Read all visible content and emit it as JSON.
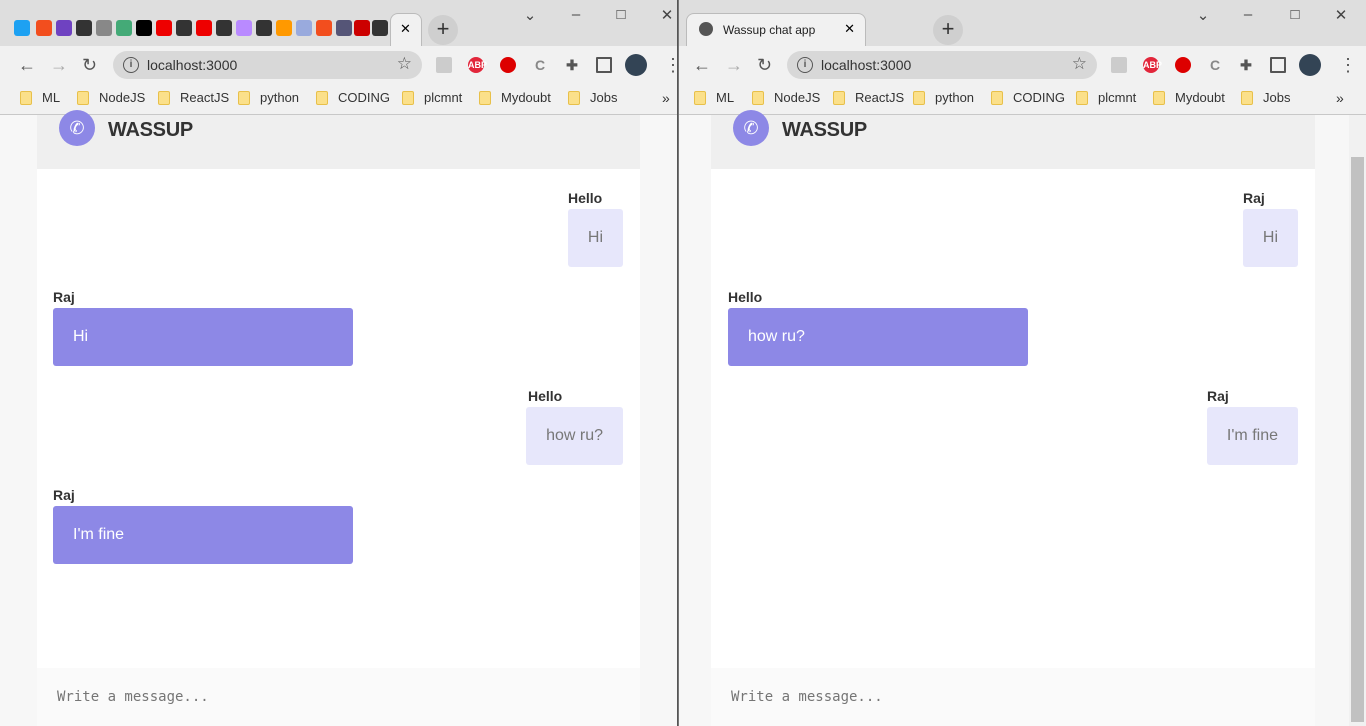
{
  "windows": [
    {
      "tab_title": "",
      "url": "localhost:3000",
      "bookmarks": [
        "ML",
        "NodeJS",
        "ReactJS",
        "python",
        "CODING",
        "plcmnt",
        "Mydoubt",
        "Jobs"
      ],
      "app": {
        "brand": "WASSUP",
        "placeholder": "Write a message..."
      },
      "messages": [
        {
          "sender": "Hello",
          "text": "Hi",
          "own": true
        },
        {
          "sender": "Raj",
          "text": "Hi",
          "own": false
        },
        {
          "sender": "Hello",
          "text": "how ru?",
          "own": true
        },
        {
          "sender": "Raj",
          "text": "I'm fine",
          "own": false
        }
      ]
    },
    {
      "tab_title": "Wassup chat app",
      "url": "localhost:3000",
      "bookmarks": [
        "ML",
        "NodeJS",
        "ReactJS",
        "python",
        "CODING",
        "plcmnt",
        "Mydoubt",
        "Jobs"
      ],
      "app": {
        "brand": "WASSUP",
        "placeholder": "Write a message..."
      },
      "messages": [
        {
          "sender": "Raj",
          "text": "Hi",
          "own": true
        },
        {
          "sender": "Hello",
          "text": "how ru?",
          "own": false
        },
        {
          "sender": "Raj",
          "text": "I'm fine",
          "own": true
        }
      ]
    }
  ],
  "icons": {
    "close": "✕",
    "new_tab": "+",
    "back": "←",
    "forward": "→",
    "reload": "↻",
    "star": "☆",
    "menu": "⋮",
    "more": "»",
    "phone": "✆"
  },
  "colors": {
    "accent": "#8d88e6",
    "own_bubble": "#e7e7fb"
  }
}
